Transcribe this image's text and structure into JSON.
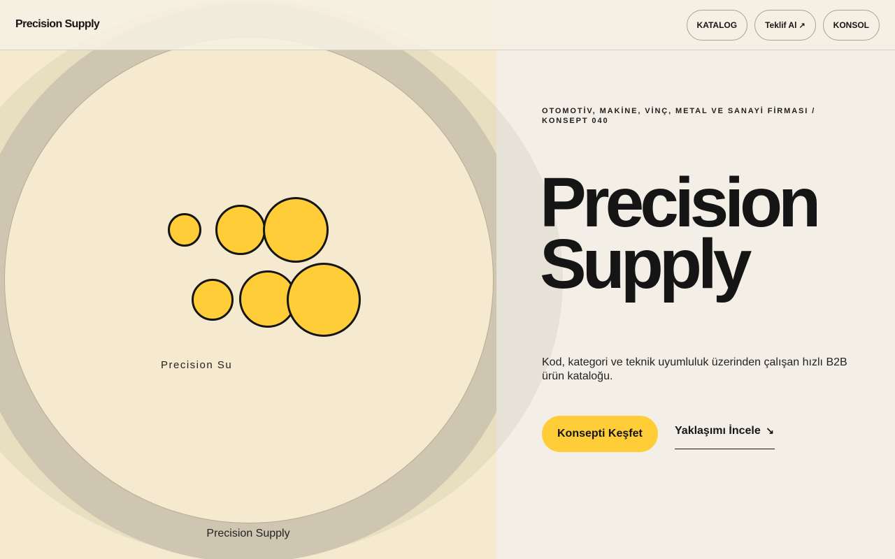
{
  "header": {
    "brand": "Precision Supply",
    "nav": [
      {
        "label": "KATALOG"
      },
      {
        "label": "Teklif Al",
        "icon": "arrow-up-right-icon",
        "icon_glyph": "↗"
      },
      {
        "label": "KONSOL"
      }
    ]
  },
  "visual": {
    "disc_caption": "Precision Su",
    "bottom_caption": "Precision Supply",
    "dot_count": 6
  },
  "hero": {
    "eyebrow": "OTOMOTİV, MAKİNE, VİNÇ, METAL VE SANAYİ FİRMASI / KONSEPT 040",
    "title_line1": "Precision",
    "title_line2": "Supply",
    "description": "Kod, kategori ve teknik uyumluluk üzerinden çalışan hızlı B2B ürün kataloğu.",
    "primary_cta": "Konsepti Keşfet",
    "secondary_cta": "Yaklaşımı İncele",
    "secondary_cta_icon": "arrow-down-right-icon",
    "secondary_cta_glyph": "↘"
  },
  "colors": {
    "accent_yellow": "#ffcd38",
    "ink": "#151515",
    "background": "#f4efe6",
    "panel_cream": "#f5ead0"
  }
}
